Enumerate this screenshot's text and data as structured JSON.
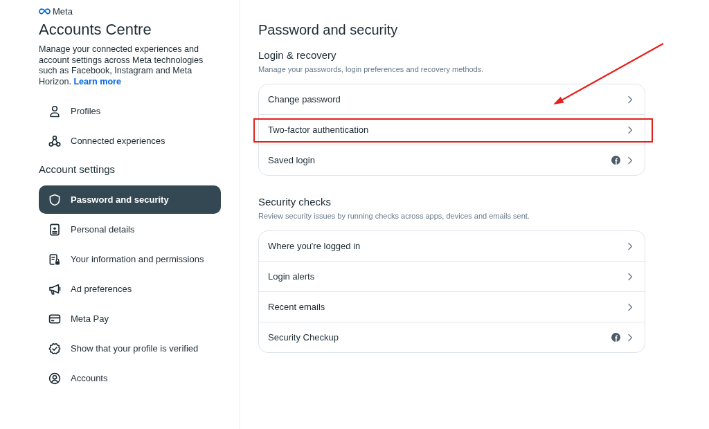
{
  "sidebar": {
    "logo": "Meta",
    "title": "Accounts Centre",
    "description": "Manage your connected experiences and account settings across Meta technologies such as Facebook, Instagram and Meta Horizon.",
    "link": "Learn more",
    "items": [
      {
        "label": "Profiles",
        "selected": false
      },
      {
        "label": "Connected experiences",
        "selected": false
      }
    ],
    "settings_heading": "Account settings",
    "settings_items": [
      {
        "label": "Password and security",
        "selected": true
      },
      {
        "label": "Personal details",
        "selected": false
      },
      {
        "label": "Your information and permissions",
        "selected": false
      },
      {
        "label": "Ad preferences",
        "selected": false
      },
      {
        "label": "Meta Pay",
        "selected": false
      },
      {
        "label": "Show that your profile is verified",
        "selected": false
      },
      {
        "label": "Accounts",
        "selected": false
      }
    ]
  },
  "main": {
    "title": "Password and security",
    "sections": [
      {
        "title": "Login & recovery",
        "subtitle": "Manage your passwords, login preferences and recovery methods.",
        "rows": [
          {
            "label": "Change password",
            "app_icon": false,
            "highlighted": false
          },
          {
            "label": "Two-factor authentication",
            "app_icon": false,
            "highlighted": true
          },
          {
            "label": "Saved login",
            "app_icon": true,
            "highlighted": false
          }
        ]
      },
      {
        "title": "Security checks",
        "subtitle": "Review security issues by running checks across apps, devices and emails sent.",
        "rows": [
          {
            "label": "Where you're logged in",
            "app_icon": false,
            "highlighted": false
          },
          {
            "label": "Login alerts",
            "app_icon": false,
            "highlighted": false
          },
          {
            "label": "Recent emails",
            "app_icon": false,
            "highlighted": false
          },
          {
            "label": "Security Checkup",
            "app_icon": true,
            "highlighted": false
          }
        ]
      }
    ]
  }
}
